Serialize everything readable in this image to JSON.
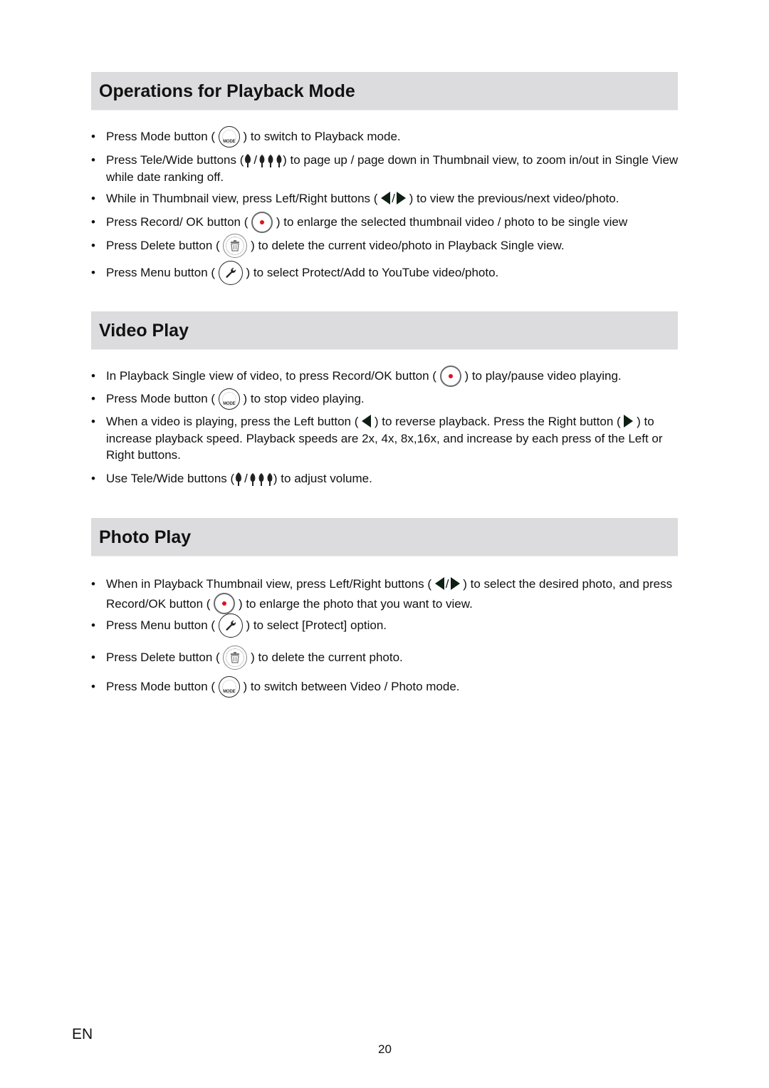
{
  "sections": [
    {
      "title": "Operations for Playback Mode",
      "items": [
        {
          "before": "Press Mode button (",
          "icon": "mode-icon",
          "after": ") to switch to Playback mode."
        },
        {
          "before": "Press Tele/Wide buttons (",
          "icon": "tele-wide-icon",
          "after": ") to page up / page down in Thumbnail view, to zoom in/out in Single View while date ranking off."
        },
        {
          "before": "While in Thumbnail view, press Left/Right buttons (",
          "icon": "left-right-icon",
          "after": ") to view the previous/next video/photo."
        },
        {
          "before": "Press Record/ OK button (",
          "icon": "record-ok-icon",
          "after": ") to enlarge the selected thumbnail video / photo to be single view"
        },
        {
          "before": "Press Delete button (",
          "icon": "delete-icon",
          "after": ") to delete the current video/photo in Playback Single view."
        },
        {
          "before": "Press Menu button (",
          "icon": "menu-icon",
          "after": ") to select Protect/Add to YouTube video/photo."
        }
      ]
    },
    {
      "title": "Video Play",
      "items": [
        {
          "before": "In Playback Single view of video, to press Record/OK button (",
          "icon": "record-ok-icon",
          "after": ") to play/pause video playing."
        },
        {
          "before": "Press Mode button (",
          "icon": "mode-icon",
          "after": ") to stop video playing."
        },
        {
          "before": "When a video is playing, press the Left button (",
          "icon": "left-icon",
          "middle": ") to reverse playback. Press the Right button (",
          "icon2": "right-icon",
          "after": ") to increase playback speed. Playback speeds are 2x, 4x, 8x,16x, and increase by each press of the Left or Right buttons."
        },
        {
          "before": "Use Tele/Wide buttons (",
          "icon": "tele-wide-icon",
          "after": ") to adjust volume."
        }
      ]
    },
    {
      "title": "Photo Play",
      "items": [
        {
          "before": "When in Playback Thumbnail view, press Left/Right buttons (",
          "icon": "left-right-icon",
          "middle": ") to select the desired photo, and press Record/OK button (",
          "icon2": "record-ok-icon",
          "after": ") to enlarge the photo that you want to view."
        },
        {
          "before": "Press Menu button (",
          "icon": "menu-icon",
          "after": ") to select [Protect] option."
        },
        {
          "before": "Press Delete button (",
          "icon": "delete-icon",
          "after": ") to delete the current photo."
        },
        {
          "before": "Press Mode button (",
          "icon": "mode-icon",
          "after": ") to switch between Video / Photo mode."
        }
      ]
    }
  ],
  "icons": {
    "mode_label": "MODE",
    "slash": "/"
  },
  "bullet_char": "•",
  "footer": {
    "language": "EN",
    "page_number": "20"
  },
  "colors": {
    "section_bar": "#dcdcde",
    "record_dot": "#e01020",
    "arrow": "#0f1f14"
  }
}
